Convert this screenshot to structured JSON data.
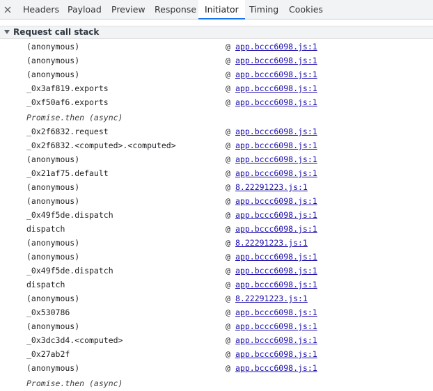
{
  "tabs": [
    "Headers",
    "Payload",
    "Preview",
    "Response",
    "Initiator",
    "Timing",
    "Cookies"
  ],
  "active_tab": "Initiator",
  "section_title": "Request call stack",
  "frames": [
    {
      "fn": "(anonymous)",
      "loc": "app.bccc6098.js:1"
    },
    {
      "fn": "(anonymous)",
      "loc": "app.bccc6098.js:1"
    },
    {
      "fn": "(anonymous)",
      "loc": "app.bccc6098.js:1"
    },
    {
      "fn": "_0x3af819.exports",
      "loc": "app.bccc6098.js:1"
    },
    {
      "fn": "_0xf50af6.exports",
      "loc": "app.bccc6098.js:1"
    },
    {
      "fn": "Promise.then (async)",
      "async": true
    },
    {
      "fn": "_0x2f6832.request",
      "loc": "app.bccc6098.js:1"
    },
    {
      "fn": "_0x2f6832.<computed>.<computed>",
      "loc": "app.bccc6098.js:1"
    },
    {
      "fn": "(anonymous)",
      "loc": "app.bccc6098.js:1"
    },
    {
      "fn": "_0x21af75.default",
      "loc": "app.bccc6098.js:1"
    },
    {
      "fn": "(anonymous)",
      "loc": "8.22291223.js:1"
    },
    {
      "fn": "(anonymous)",
      "loc": "app.bccc6098.js:1"
    },
    {
      "fn": "_0x49f5de.dispatch",
      "loc": "app.bccc6098.js:1"
    },
    {
      "fn": "dispatch",
      "loc": "app.bccc6098.js:1"
    },
    {
      "fn": "(anonymous)",
      "loc": "8.22291223.js:1"
    },
    {
      "fn": "(anonymous)",
      "loc": "app.bccc6098.js:1"
    },
    {
      "fn": "_0x49f5de.dispatch",
      "loc": "app.bccc6098.js:1"
    },
    {
      "fn": "dispatch",
      "loc": "app.bccc6098.js:1"
    },
    {
      "fn": "(anonymous)",
      "loc": "8.22291223.js:1"
    },
    {
      "fn": "_0x530786",
      "loc": "app.bccc6098.js:1"
    },
    {
      "fn": "(anonymous)",
      "loc": "app.bccc6098.js:1"
    },
    {
      "fn": "_0x3dc3d4.<computed>",
      "loc": "app.bccc6098.js:1"
    },
    {
      "fn": "_0x27ab2f",
      "loc": "app.bccc6098.js:1"
    },
    {
      "fn": "(anonymous)",
      "loc": "app.bccc6098.js:1"
    },
    {
      "fn": "Promise.then (async)",
      "async": true
    }
  ],
  "at_symbol": "@",
  "colors": {
    "link": "#1a0dab",
    "active_tab_underline": "#1a73e8",
    "header_bg": "#f1f3f4"
  },
  "icons": {
    "close": "close-icon",
    "section_toggle": "triangle-down-icon"
  }
}
